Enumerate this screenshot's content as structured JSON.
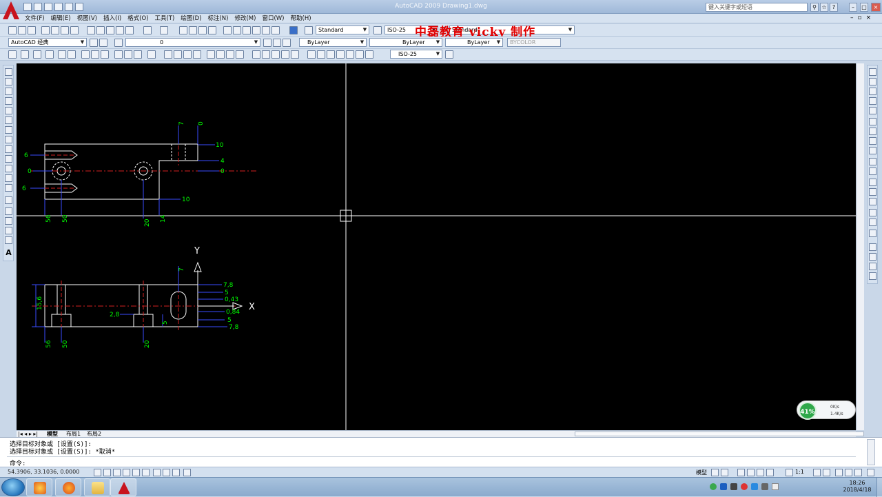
{
  "titlebar": {
    "window_title": "AutoCAD 2009 Drawing1.dwg",
    "search_placeholder": "键入关键字或短语"
  },
  "menu": {
    "items": [
      "文件(F)",
      "编辑(E)",
      "视图(V)",
      "插入(I)",
      "格式(O)",
      "工具(T)",
      "绘图(D)",
      "标注(N)",
      "修改(M)",
      "窗口(W)",
      "帮助(H)"
    ]
  },
  "toolbar": {
    "text_style": "Standard",
    "dim_style": "ISO-25",
    "table_style": "Standard",
    "workspace": "AutoCAD 经典",
    "layer": "0",
    "color": "ByLayer",
    "linetype": "ByLayer",
    "lineweight": "ByLayer",
    "plot_style": "BYCOLOR",
    "dim_style_2": "ISO-25",
    "watermark": "中磊教育 vicky 制作"
  },
  "drawing": {
    "top_view": {
      "dim_top": [
        "7",
        "0"
      ],
      "dim_right": [
        "10",
        "4",
        "0"
      ],
      "dim_left": [
        "6",
        "0",
        "6"
      ],
      "dim_bottom_right": "10",
      "dim_bottom": [
        "56",
        "50",
        "20",
        "14"
      ]
    },
    "front_view": {
      "axis_y": "Y",
      "axis_x": "X",
      "dim_top": "7",
      "dim_right": [
        "7,8",
        "5",
        "0,43",
        "0,84",
        "5",
        "7,8"
      ],
      "dim_left": "15,6",
      "dim_mid": "2,8",
      "dim_slot": "5",
      "dim_bottom": [
        "56",
        "50",
        "20"
      ]
    }
  },
  "layout_tabs": [
    "模型",
    "布局1",
    "布局2"
  ],
  "command": {
    "line1": "选择目标对象或 [设置(S)]:",
    "line2": "选择目标对象或 [设置(S)]: *取消*",
    "prompt": "命令:"
  },
  "status": {
    "coords": "54.3906, 33.1036, 0.0000",
    "model": "模型",
    "scale": "1:1"
  },
  "net_widget": {
    "percent": "41%",
    "up": "0K/s",
    "down": "1.4K/s"
  },
  "taskbar": {
    "time": "18:26",
    "date": "2018/4/18"
  },
  "colors": {
    "dim_green": "#00ff00",
    "dim_blue": "#3a4dff",
    "center_red": "#d42020",
    "geometry_white": "#ffffff",
    "watermark_red": "#e00000"
  }
}
